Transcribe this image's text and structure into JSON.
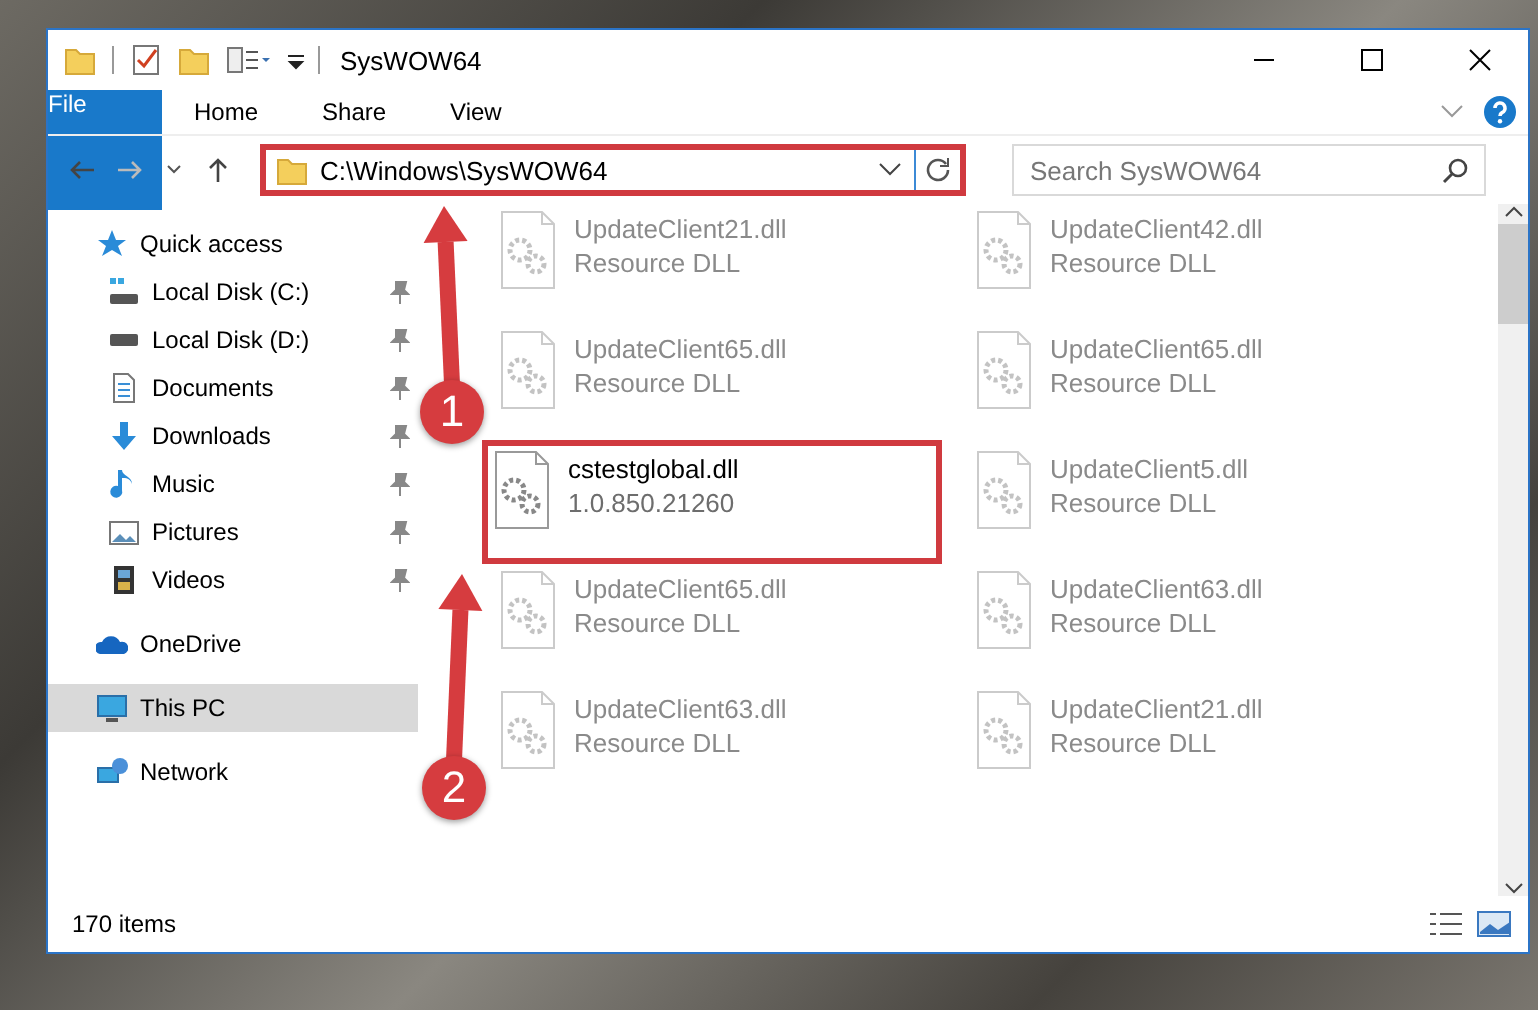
{
  "window": {
    "title": "SysWOW64"
  },
  "ribbon_tabs": [
    {
      "label": "File",
      "kind": "file"
    },
    {
      "label": "Home",
      "kind": "tab"
    },
    {
      "label": "Share",
      "kind": "tab"
    },
    {
      "label": "View",
      "kind": "tab"
    }
  ],
  "address_bar": {
    "value": "C:\\Windows\\SysWOW64",
    "highlighted": true
  },
  "search": {
    "placeholder": "Search SysWOW64"
  },
  "sidebar": {
    "items": [
      {
        "label": "Quick access",
        "kind": "star",
        "selected": false,
        "children": [
          {
            "label": "Local Disk (C:)",
            "kind": "system-drive",
            "pinned": true,
            "selected": false
          },
          {
            "label": "Local Disk (D:)",
            "kind": "drive",
            "pinned": true,
            "selected": false
          },
          {
            "label": "Documents",
            "kind": "documents",
            "pinned": true,
            "selected": false
          },
          {
            "label": "Downloads",
            "kind": "downloads",
            "pinned": true,
            "selected": false
          },
          {
            "label": "Music",
            "kind": "music",
            "pinned": true,
            "selected": false
          },
          {
            "label": "Pictures",
            "kind": "pictures",
            "pinned": true,
            "selected": false
          },
          {
            "label": "Videos",
            "kind": "videos",
            "pinned": true,
            "selected": false
          }
        ]
      },
      {
        "label": "OneDrive",
        "kind": "cloud",
        "selected": false
      },
      {
        "label": "This PC",
        "kind": "computer",
        "selected": true
      },
      {
        "label": "Network",
        "kind": "network",
        "selected": false
      }
    ]
  },
  "files": [
    {
      "name": "UpdateClient21.dll",
      "detail": "Resource DLL",
      "blurred": true,
      "highlighted": false
    },
    {
      "name": "UpdateClient42.dll",
      "detail": "Resource DLL",
      "blurred": true,
      "highlighted": false
    },
    {
      "name": "UpdateClient65.dll",
      "detail": "Resource DLL",
      "blurred": true,
      "highlighted": false
    },
    {
      "name": "UpdateClient65.dll",
      "detail": "Resource DLL",
      "blurred": true,
      "highlighted": false
    },
    {
      "name": "cstestglobal.dll",
      "detail": "1.0.850.21260",
      "blurred": false,
      "highlighted": true
    },
    {
      "name": "UpdateClient5.dll",
      "detail": "Resource DLL",
      "blurred": true,
      "highlighted": false
    },
    {
      "name": "UpdateClient65.dll",
      "detail": "Resource DLL",
      "blurred": true,
      "highlighted": false
    },
    {
      "name": "UpdateClient63.dll",
      "detail": "Resource DLL",
      "blurred": true,
      "highlighted": false
    },
    {
      "name": "UpdateClient63.dll",
      "detail": "Resource DLL",
      "blurred": true,
      "highlighted": false
    },
    {
      "name": "UpdateClient21.dll",
      "detail": "Resource DLL",
      "blurred": true,
      "highlighted": false
    }
  ],
  "status_bar": {
    "item_count": "170 items"
  },
  "annotations": [
    {
      "number": "1"
    },
    {
      "number": "2"
    }
  ]
}
